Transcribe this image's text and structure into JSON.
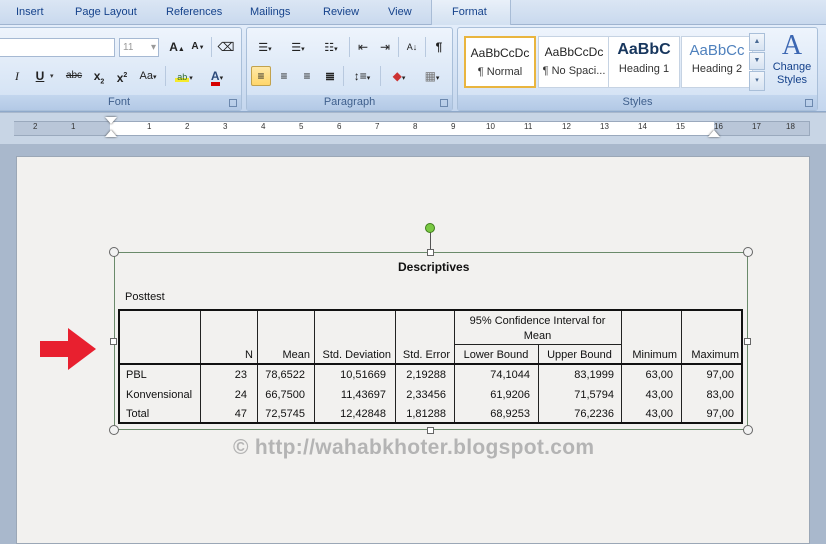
{
  "tabs": [
    "Insert",
    "Page Layout",
    "References",
    "Mailings",
    "Review",
    "View",
    "Format"
  ],
  "font_group": {
    "label": "Font",
    "font_name": "",
    "font_size": "11",
    "grow": "A",
    "shrink": "A",
    "italic": "I",
    "underline": "U",
    "strike": "abc",
    "subscript": "x",
    "superscript": "x",
    "change_case": "Aa",
    "font_color": "A"
  },
  "paragraph_group": {
    "label": "Paragraph",
    "pilcrow": "¶"
  },
  "styles_group": {
    "label": "Styles",
    "change_styles": [
      "Change",
      "Styles"
    ],
    "styles": [
      {
        "sample": "AaBbCcDc",
        "name": "¶ Normal"
      },
      {
        "sample": "AaBbCcDc",
        "name": "¶ No Spaci..."
      },
      {
        "sample": "AaBbC",
        "name": "Heading 1"
      },
      {
        "sample": "AaBbCc",
        "name": "Heading 2"
      }
    ]
  },
  "ruler": {
    "numbers": [
      "2",
      "1",
      "1",
      "2",
      "3",
      "4",
      "5",
      "6",
      "7",
      "8",
      "9",
      "10",
      "11",
      "12",
      "13",
      "14",
      "15",
      "16",
      "17",
      "18"
    ]
  },
  "spss_table": {
    "title": "Descriptives",
    "subtitle": "Posttest",
    "group_header": [
      "95% Confidence Interval for",
      "Mean"
    ],
    "columns": [
      "N",
      "Mean",
      "Std. Deviation",
      "Std. Error",
      "Lower Bound",
      "Upper Bound",
      "Minimum",
      "Maximum"
    ],
    "rows": [
      {
        "label": "PBL",
        "values": [
          "23",
          "78,6522",
          "10,51669",
          "2,19288",
          "74,1044",
          "83,1999",
          "63,00",
          "97,00"
        ]
      },
      {
        "label": "Konvensional",
        "values": [
          "24",
          "66,7500",
          "11,43697",
          "2,33456",
          "61,9206",
          "71,5794",
          "43,00",
          "83,00"
        ]
      },
      {
        "label": "Total",
        "values": [
          "47",
          "72,5745",
          "12,42848",
          "1,81288",
          "68,9253",
          "76,2236",
          "43,00",
          "97,00"
        ]
      }
    ]
  },
  "watermark": "© http://wahabkhoter.blogspot.com",
  "colors": {
    "arrow": "#e8202f",
    "rotate_handle": "#7ac943",
    "selected_style": "#e9b53f"
  }
}
